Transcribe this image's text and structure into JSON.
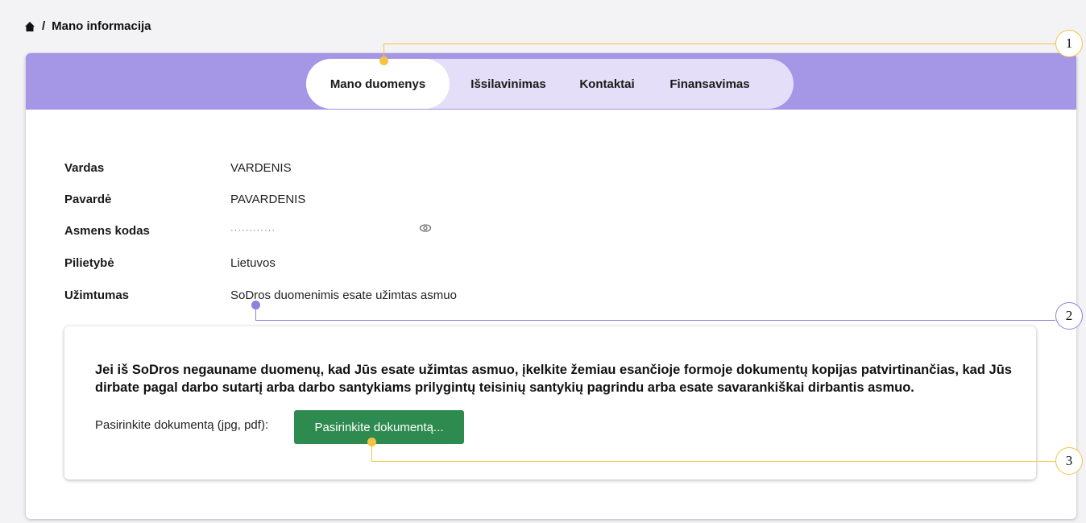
{
  "breadcrumb": {
    "home_icon": "home-icon",
    "separator": "/",
    "current": "Mano informacija"
  },
  "tabs": [
    {
      "label": "Mano duomenys",
      "active": true
    },
    {
      "label": "Išsilavinimas",
      "active": false
    },
    {
      "label": "Kontaktai",
      "active": false
    },
    {
      "label": "Finansavimas",
      "active": false
    }
  ],
  "info": [
    {
      "label": "Vardas",
      "value": "VARDENIS"
    },
    {
      "label": "Pavardė",
      "value": "PAVARDENIS"
    },
    {
      "label": "Asmens kodas",
      "value": "············",
      "icon": "eye-icon"
    },
    {
      "label": "Pilietybė",
      "value": "Lietuvos"
    },
    {
      "label": "Užimtumas",
      "value": "SoDros duomenimis esate užimtas asmuo"
    }
  ],
  "notice": {
    "text": "Jei iš SoDros negauname duomenų, kad Jūs esate užimtas asmuo, įkelkite žemiau esančioje formoje dokumentų kopijas patvirtinančias, kad Jūs dirbate pagal darbo sutartį arba darbo santykiams prilygintų teisinių santykių pagrindu arba esate savarankiškai dirbantis asmuo.",
    "upload_label": "Pasirinkite dokumentą (jpg, pdf):",
    "upload_button": "Pasirinkite dokumentą..."
  },
  "callouts": [
    {
      "number": "1",
      "color": "#f5c243"
    },
    {
      "number": "2",
      "color": "#8f80dc"
    },
    {
      "number": "3",
      "color": "#f5c243"
    }
  ],
  "colors": {
    "tab_bar": "#a596e6",
    "tab_pill": "#e4def8",
    "button": "#2e8b4f"
  }
}
